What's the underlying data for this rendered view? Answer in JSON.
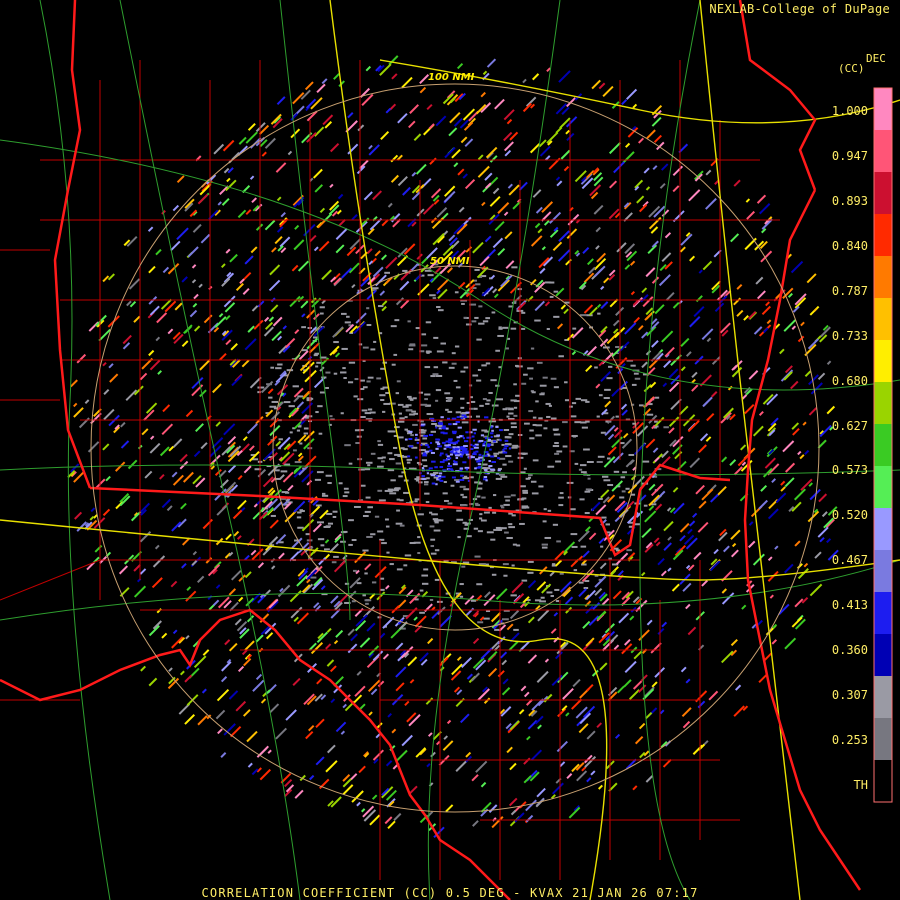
{
  "header": {
    "credit": "NEXLAB-College of DuPage"
  },
  "legend": {
    "units_top": "DEC",
    "units_bottom": "(CC)",
    "ticks": [
      "1.000",
      "0.947",
      "0.893",
      "0.840",
      "0.787",
      "0.733",
      "0.680",
      "0.627",
      "0.573",
      "0.520",
      "0.467",
      "0.413",
      "0.360",
      "0.307",
      "0.253",
      "TH"
    ],
    "colors": [
      "#ff88c0",
      "#ff5577",
      "#cc1030",
      "#ff2a00",
      "#ff7a00",
      "#ffc000",
      "#ffee00",
      "#9ad400",
      "#3acb23",
      "#55ee55",
      "#9999ff",
      "#7a7ae0",
      "#1d1df0",
      "#0000b4",
      "#9a9aa4",
      "#777780",
      "#000000"
    ]
  },
  "range_rings": [
    {
      "label": "50 NMI"
    },
    {
      "label": "100 NMI"
    }
  ],
  "footer": {
    "title": "CORRELATION COEFFICIENT (CC) 0.5 DEG - KVAX 21 JAN 26 07:17"
  }
}
